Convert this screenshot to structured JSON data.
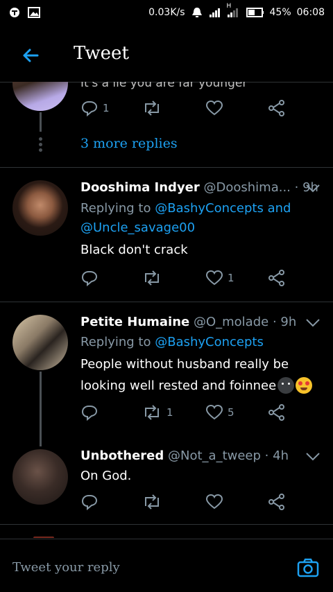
{
  "status_bar": {
    "net_speed": "0.03K/s",
    "network_label": "H",
    "battery": "45%",
    "time": "06:08"
  },
  "header": {
    "title": "Tweet"
  },
  "partial_tweet": {
    "text_fragment": "It's a lie you are far younger",
    "reply_count": "1",
    "more_replies": "3 more replies"
  },
  "tweets": [
    {
      "name": "Dooshima Indyer",
      "handle": "@Dooshima...",
      "time": "· 9h",
      "replying_to_prefix": "Replying to",
      "replying_to_1": "@BashyConcepts and",
      "replying_to_2": "@Uncle_savage00",
      "text": "Black don't crack",
      "replies": "",
      "retweets": "",
      "likes": "1"
    },
    {
      "name": "Petite Humaine",
      "handle": "@O_molade",
      "time": "· 9h",
      "replying_to_prefix": "Replying to",
      "replying_to_1": "@BashyConcepts",
      "text_line1": "People without husband really be",
      "text_line2": "looking well rested and foinnee",
      "replies": "",
      "retweets": "1",
      "likes": "5"
    },
    {
      "name": "Unbothered",
      "handle": "@Not_a_tweep",
      "time": "· 4h",
      "text": "On God.",
      "replies": "",
      "retweets": "",
      "likes": ""
    }
  ],
  "reply_bar": {
    "placeholder": "Tweet your reply"
  },
  "colors": {
    "accent": "#1da1f2",
    "muted": "#8899a6",
    "divider": "#2f3336"
  },
  "icons": [
    "back-arrow-icon",
    "reply-icon",
    "retweet-icon",
    "like-icon",
    "share-icon",
    "chevron-down-icon",
    "camera-icon"
  ]
}
